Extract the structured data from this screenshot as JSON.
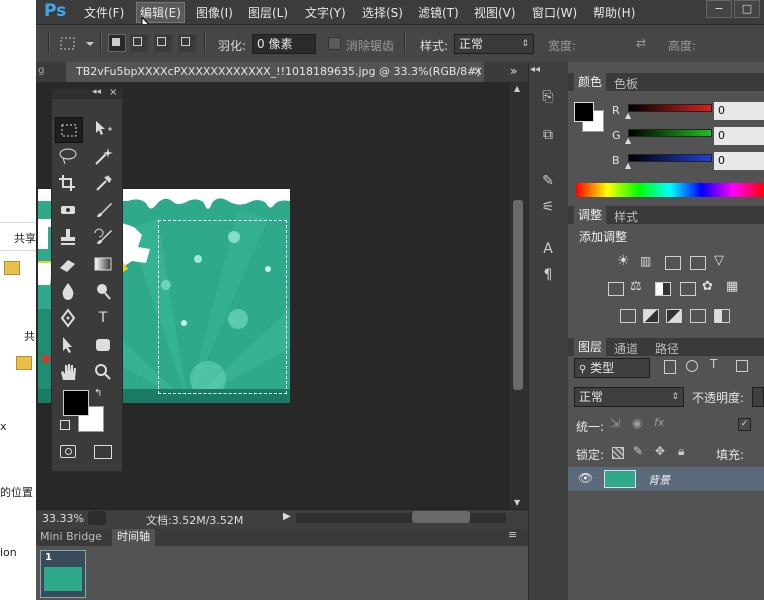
{
  "app": {
    "logo": "Ps"
  },
  "menu": [
    "文件(F)",
    "编辑(E)",
    "图像(I)",
    "图层(L)",
    "文字(Y)",
    "选择(S)",
    "滤镜(T)",
    "视图(V)",
    "窗口(W)",
    "帮助(H)"
  ],
  "window_controls": {
    "minimize": "−",
    "restore": "□"
  },
  "options_bar": {
    "feather_label": "羽化:",
    "feather_value": "0 像素",
    "antialias_label": "消除锯齿",
    "style_label": "样式:",
    "style_value": "正常",
    "width_label": "宽度:",
    "height_label": "高度:"
  },
  "document": {
    "tab_title": "TB2vFu5bpXXXXcPXXXXXXXXXXXX_!!1018189635.jpg @ 33.3%(RGB/8#)",
    "tab_close": "×",
    "collapse_glyph": "»"
  },
  "status": {
    "zoom": "33.33%",
    "doc_info": "文档:3.52M/3.52M"
  },
  "bottom_tabs": [
    "Mini Bridge",
    "时间轴"
  ],
  "timeline": {
    "frame_number": "1"
  },
  "color_panel": {
    "tabs": [
      "颜色",
      "色板"
    ],
    "channels": [
      {
        "label": "R",
        "value": "0",
        "color": "#d02020"
      },
      {
        "label": "G",
        "value": "0",
        "color": "#20b020"
      },
      {
        "label": "B",
        "value": "0",
        "color": "#2040d0"
      }
    ]
  },
  "adjust_panel": {
    "tabs": [
      "调整",
      "样式"
    ],
    "title": "添加调整"
  },
  "layers_panel": {
    "tabs": [
      "图层",
      "通道",
      "路径"
    ],
    "filter_value": "类型",
    "blend_mode": "正常",
    "opacity_label": "不透明度:",
    "unify_label": "统一:",
    "lock_label": "锁定:",
    "fill_label": "填充:",
    "layer_name": "背景"
  },
  "left_window": {
    "texts": [
      "共享",
      "共",
      "x",
      "的位置",
      "ion"
    ]
  },
  "colors": {
    "accent": "#3fa7ea",
    "canvas_green": "#2fa98a",
    "layer_selected": "#5a6a7a"
  }
}
